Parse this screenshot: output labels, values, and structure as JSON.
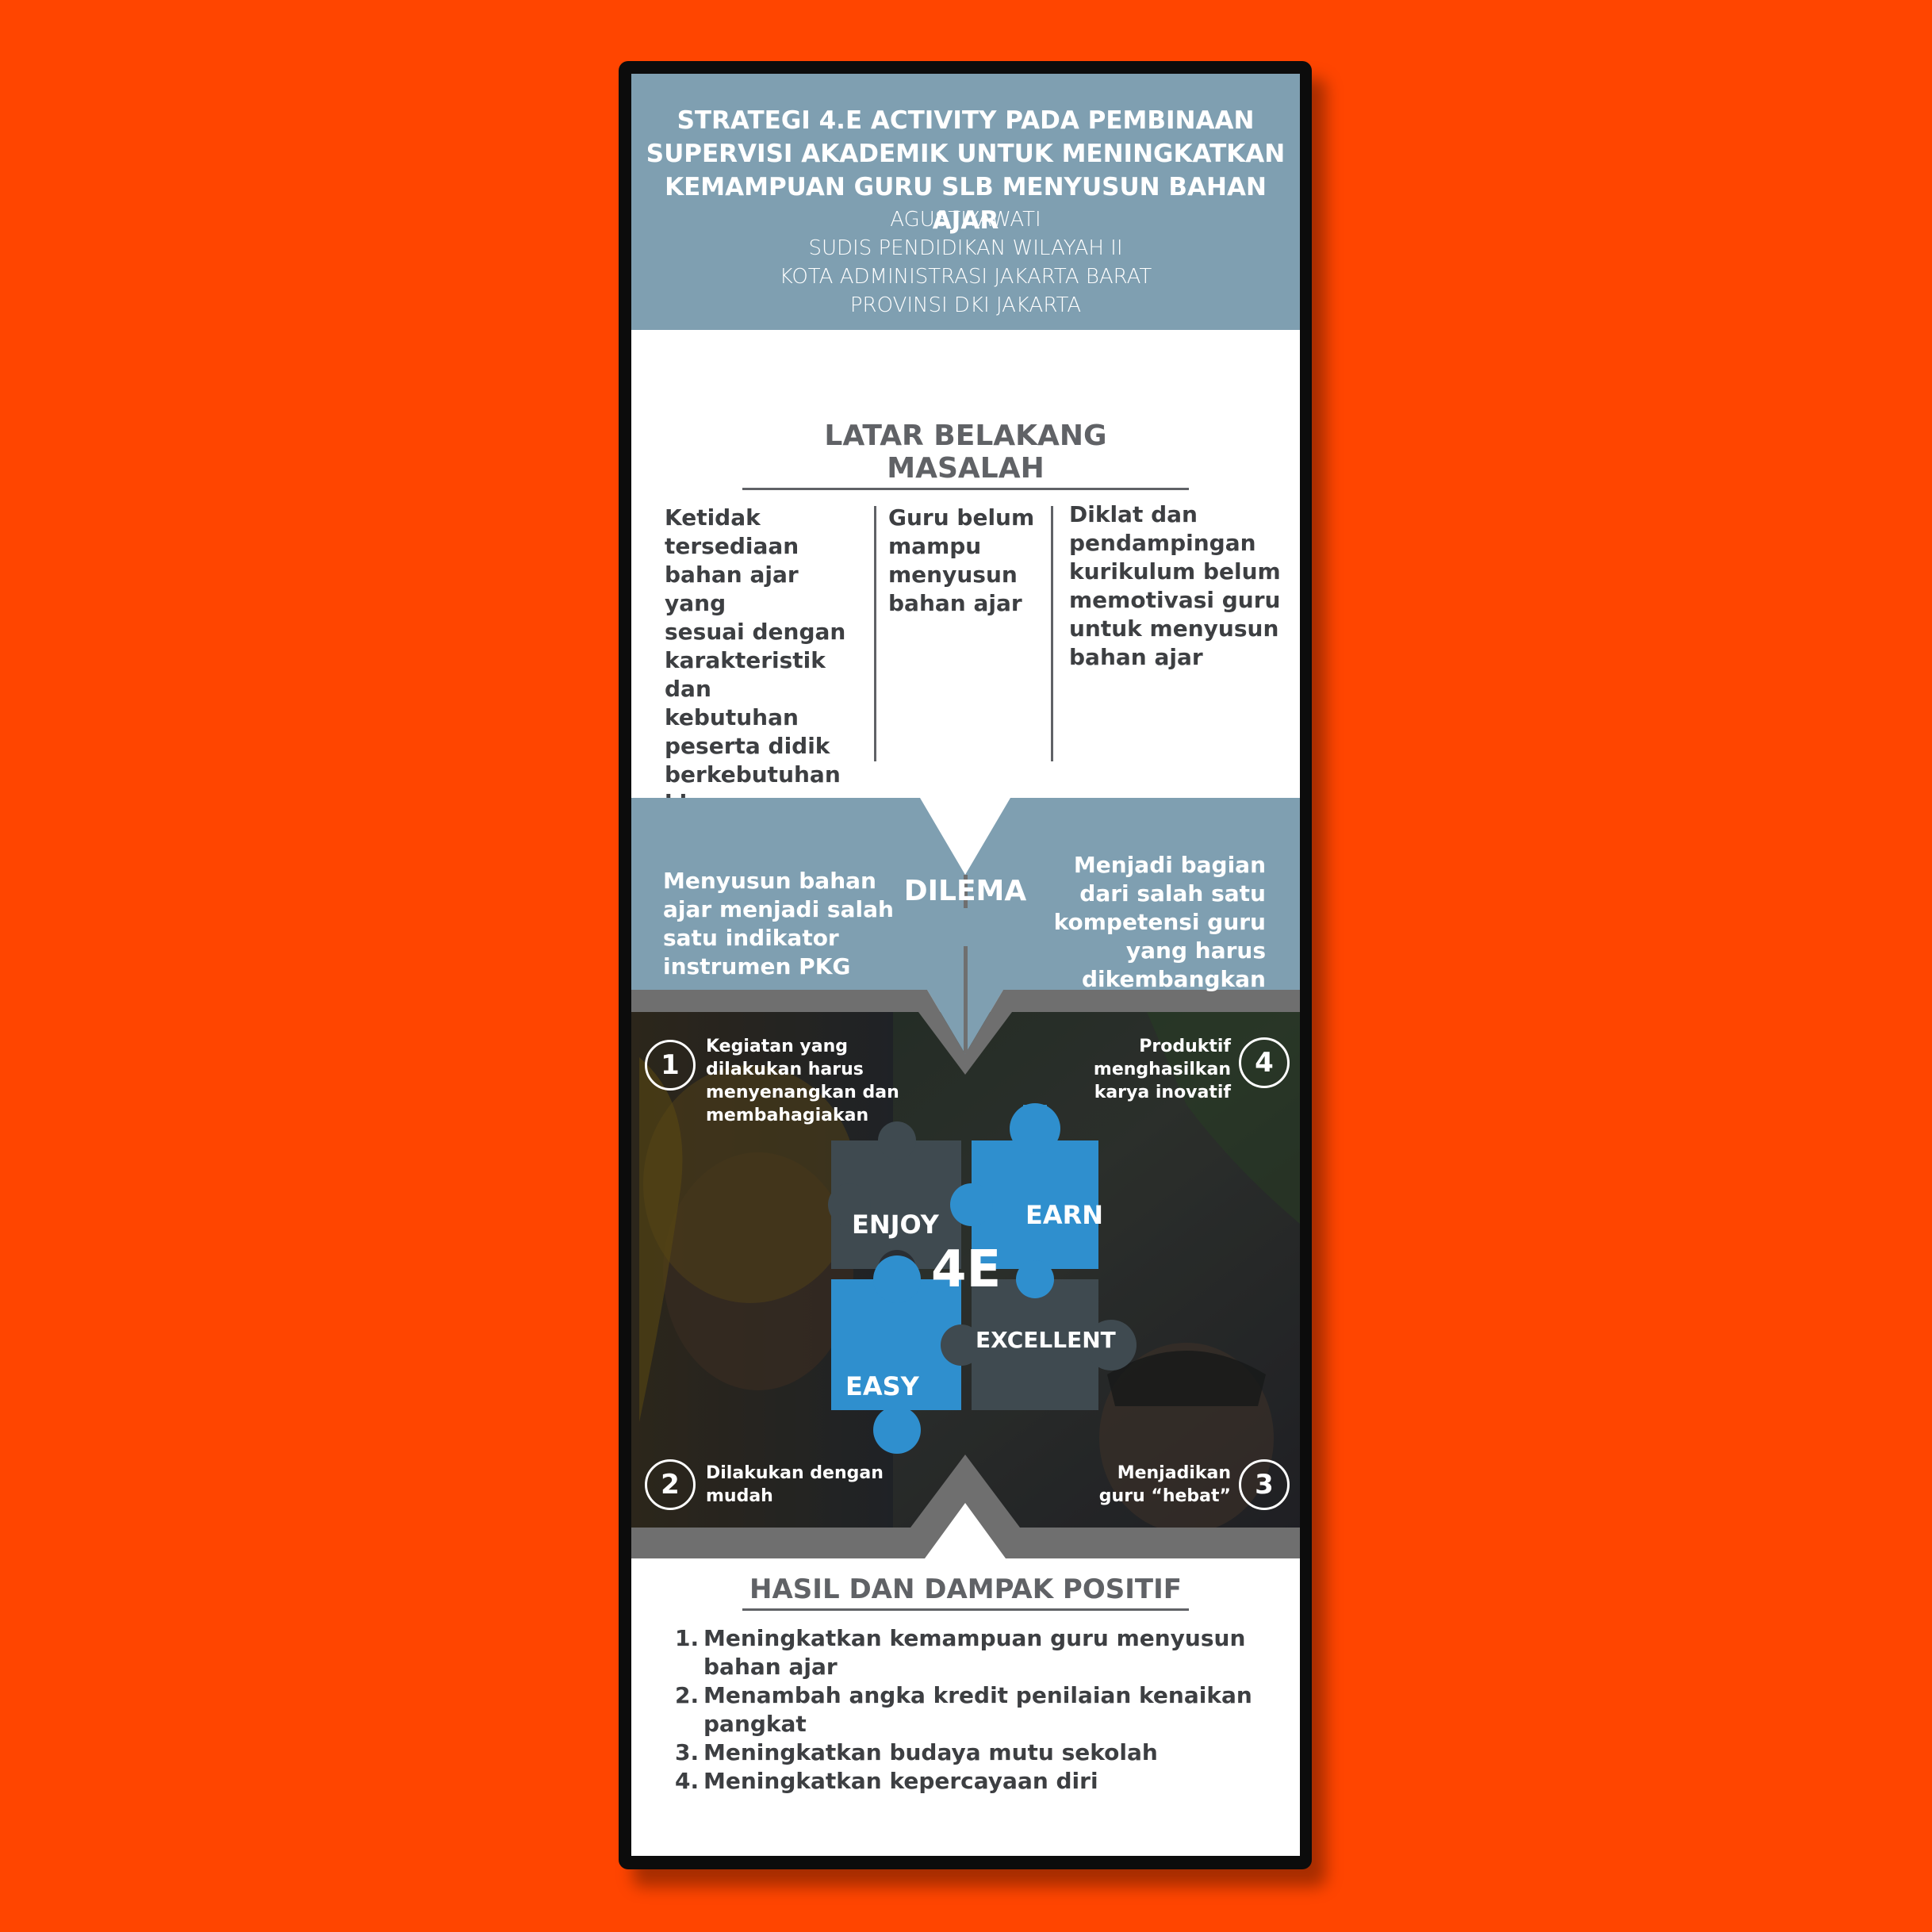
{
  "colors": {
    "background": "#ff4500",
    "header": "#7f9fb1",
    "puzzle_blue": "#2f8fce",
    "puzzle_dark": "#3f4a50",
    "text_dark": "#3d3f42"
  },
  "header": {
    "title": "STRATEGI 4.E ACTIVITY PADA PEMBINAAN\nSUPERVISI AKADEMIK UNTUK MENINGKATKAN\nKEMAMPUAN GURU SLB MENYUSUN BAHAN AJAR",
    "author_block": "AGUSTIYAWATI\nSUDIS PENDIDIKAN WILAYAH II\nKOTA ADMINISTRASI JAKARTA BARAT\nPROVINSI DKI JAKARTA"
  },
  "background_section": {
    "heading": "LATAR BELAKANG MASALAH",
    "columns": [
      "Ketidak\ntersediaan\nbahan ajar yang\nsesuai dengan\nkarakteristik dan\nkebutuhan\npeserta didik\nberkebutuhan\nkhusus",
      "Guru belum\nmampu\nmenyusun\nbahan ajar",
      "Diklat dan\npendampingan\nkurikulum belum\nmemotivasi guru\nuntuk menyusun\nbahan ajar"
    ]
  },
  "dilema": {
    "label": "DILEMA",
    "left": "Menyusun bahan\najar menjadi salah\nsatu indikator\ninstrumen PKG",
    "right": "Menjadi bagian\ndari salah satu\nkompetensi guru\nyang harus\ndikembangkan"
  },
  "strategy": {
    "center": "4E",
    "pieces": {
      "enjoy": "ENJOY",
      "earn": "EARN",
      "easy": "EASY",
      "excellent": "EXCELLENT"
    },
    "steps": [
      {
        "num": "1",
        "text": "Kegiatan yang\ndilakukan harus\nmenyenangkan dan\nmembahagiakan"
      },
      {
        "num": "2",
        "text": "Dilakukan dengan\nmudah"
      },
      {
        "num": "3",
        "text": "Menjadikan\nguru “hebat”"
      },
      {
        "num": "4",
        "text": "Produktif\nmenghasilkan\nkarya inovatif"
      }
    ]
  },
  "results": {
    "heading": "HASIL DAN DAMPAK POSITIF",
    "items": [
      {
        "num": "1.",
        "text": "Meningkatkan kemampuan guru menyusun bahan ajar"
      },
      {
        "num": "2.",
        "text": "Menambah angka kredit penilaian kenaikan pangkat"
      },
      {
        "num": "3.",
        "text": "Meningkatkan budaya mutu sekolah"
      },
      {
        "num": "4.",
        "text": "Meningkatkan kepercayaan diri"
      }
    ]
  }
}
